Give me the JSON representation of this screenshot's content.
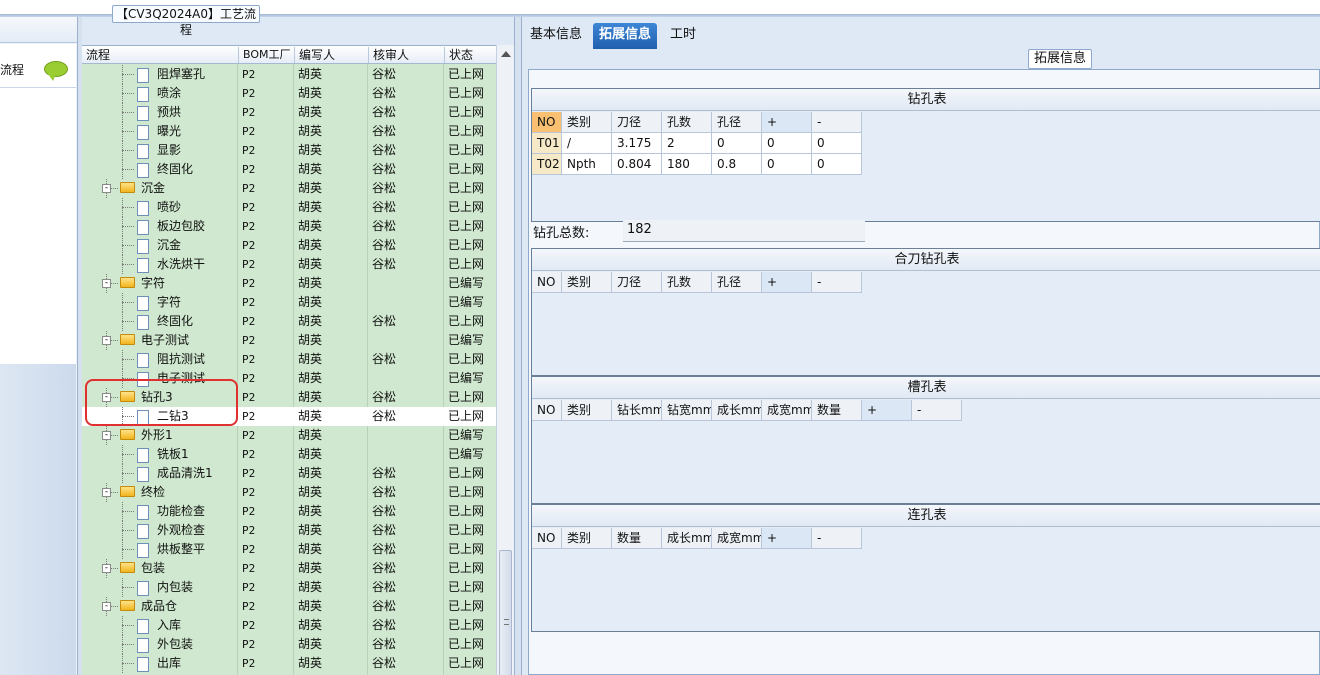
{
  "left_panel": {
    "flow_label": "流程"
  },
  "middle": {
    "title": "【CV3Q2024A0】工艺流程",
    "columns": [
      "流程",
      "BOM工厂",
      "编写人",
      "核审人",
      "状态"
    ],
    "rows": [
      {
        "indent": 2,
        "type": "file",
        "name": "阻焊塞孔",
        "bom": "P2",
        "writer": "胡英",
        "reviewer": "谷松",
        "status": "已上网"
      },
      {
        "indent": 2,
        "type": "file",
        "name": "喷涂",
        "bom": "P2",
        "writer": "胡英",
        "reviewer": "谷松",
        "status": "已上网"
      },
      {
        "indent": 2,
        "type": "file",
        "name": "预烘",
        "bom": "P2",
        "writer": "胡英",
        "reviewer": "谷松",
        "status": "已上网"
      },
      {
        "indent": 2,
        "type": "file",
        "name": "曝光",
        "bom": "P2",
        "writer": "胡英",
        "reviewer": "谷松",
        "status": "已上网"
      },
      {
        "indent": 2,
        "type": "file",
        "name": "显影",
        "bom": "P2",
        "writer": "胡英",
        "reviewer": "谷松",
        "status": "已上网"
      },
      {
        "indent": 2,
        "type": "file",
        "name": "终固化",
        "bom": "P2",
        "writer": "胡英",
        "reviewer": "谷松",
        "status": "已上网"
      },
      {
        "indent": 1,
        "type": "folder",
        "name": "沉金",
        "bom": "P2",
        "writer": "胡英",
        "reviewer": "谷松",
        "status": "已上网"
      },
      {
        "indent": 2,
        "type": "file",
        "name": "喷砂",
        "bom": "P2",
        "writer": "胡英",
        "reviewer": "谷松",
        "status": "已上网"
      },
      {
        "indent": 2,
        "type": "file",
        "name": "板边包胶",
        "bom": "P2",
        "writer": "胡英",
        "reviewer": "谷松",
        "status": "已上网"
      },
      {
        "indent": 2,
        "type": "file",
        "name": "沉金",
        "bom": "P2",
        "writer": "胡英",
        "reviewer": "谷松",
        "status": "已上网"
      },
      {
        "indent": 2,
        "type": "file",
        "name": "水洗烘干",
        "bom": "P2",
        "writer": "胡英",
        "reviewer": "谷松",
        "status": "已上网"
      },
      {
        "indent": 1,
        "type": "folder",
        "name": "字符",
        "bom": "P2",
        "writer": "胡英",
        "reviewer": "",
        "status": "已编写"
      },
      {
        "indent": 2,
        "type": "file",
        "name": "字符",
        "bom": "P2",
        "writer": "胡英",
        "reviewer": "",
        "status": "已编写"
      },
      {
        "indent": 2,
        "type": "file",
        "name": "终固化",
        "bom": "P2",
        "writer": "胡英",
        "reviewer": "谷松",
        "status": "已上网"
      },
      {
        "indent": 1,
        "type": "folder",
        "name": "电子测试",
        "bom": "P2",
        "writer": "胡英",
        "reviewer": "",
        "status": "已编写"
      },
      {
        "indent": 2,
        "type": "file",
        "name": "阻抗测试",
        "bom": "P2",
        "writer": "胡英",
        "reviewer": "谷松",
        "status": "已上网"
      },
      {
        "indent": 2,
        "type": "file",
        "name": "电子测试",
        "bom": "P2",
        "writer": "胡英",
        "reviewer": "",
        "status": "已编写"
      },
      {
        "indent": 1,
        "type": "folder",
        "name": "钻孔3",
        "bom": "P2",
        "writer": "胡英",
        "reviewer": "谷松",
        "status": "已上网"
      },
      {
        "indent": 2,
        "type": "file",
        "name": "二钻3",
        "bom": "P2",
        "writer": "胡英",
        "reviewer": "谷松",
        "status": "已上网",
        "selected": true
      },
      {
        "indent": 1,
        "type": "folder",
        "name": "外形1",
        "bom": "P2",
        "writer": "胡英",
        "reviewer": "",
        "status": "已编写"
      },
      {
        "indent": 2,
        "type": "file",
        "name": "铣板1",
        "bom": "P2",
        "writer": "胡英",
        "reviewer": "",
        "status": "已编写"
      },
      {
        "indent": 2,
        "type": "file",
        "name": "成品清洗1",
        "bom": "P2",
        "writer": "胡英",
        "reviewer": "谷松",
        "status": "已上网"
      },
      {
        "indent": 1,
        "type": "folder",
        "name": "终检",
        "bom": "P2",
        "writer": "胡英",
        "reviewer": "谷松",
        "status": "已上网"
      },
      {
        "indent": 2,
        "type": "file",
        "name": "功能检查",
        "bom": "P2",
        "writer": "胡英",
        "reviewer": "谷松",
        "status": "已上网"
      },
      {
        "indent": 2,
        "type": "file",
        "name": "外观检查",
        "bom": "P2",
        "writer": "胡英",
        "reviewer": "谷松",
        "status": "已上网"
      },
      {
        "indent": 2,
        "type": "file",
        "name": "烘板整平",
        "bom": "P2",
        "writer": "胡英",
        "reviewer": "谷松",
        "status": "已上网"
      },
      {
        "indent": 1,
        "type": "folder",
        "name": "包装",
        "bom": "P2",
        "writer": "胡英",
        "reviewer": "谷松",
        "status": "已上网"
      },
      {
        "indent": 2,
        "type": "file",
        "name": "内包装",
        "bom": "P2",
        "writer": "胡英",
        "reviewer": "谷松",
        "status": "已上网"
      },
      {
        "indent": 1,
        "type": "folder",
        "name": "成品仓",
        "bom": "P2",
        "writer": "胡英",
        "reviewer": "谷松",
        "status": "已上网"
      },
      {
        "indent": 2,
        "type": "file",
        "name": "入库",
        "bom": "P2",
        "writer": "胡英",
        "reviewer": "谷松",
        "status": "已上网"
      },
      {
        "indent": 2,
        "type": "file",
        "name": "外包装",
        "bom": "P2",
        "writer": "胡英",
        "reviewer": "谷松",
        "status": "已上网"
      },
      {
        "indent": 2,
        "type": "file",
        "name": "出库",
        "bom": "P2",
        "writer": "胡英",
        "reviewer": "谷松",
        "status": "已上网"
      }
    ]
  },
  "right": {
    "tabs": [
      "基本信息",
      "拓展信息",
      "工时"
    ],
    "active_tab": "拓展信息",
    "panel_title": "拓展信息",
    "drill_table": {
      "title": "钻孔表",
      "headers": [
        "NO",
        "类别",
        "刀径",
        "孔数",
        "孔径",
        "+",
        "-"
      ],
      "rows": [
        [
          "T01",
          "/",
          "3.175",
          "2",
          "0",
          "0",
          "0"
        ],
        [
          "T02",
          "Npth",
          "0.804",
          "180",
          "0.8",
          "0",
          "0"
        ]
      ]
    },
    "total_label": "钻孔总数:",
    "total_value": "182",
    "merge_table": {
      "title": "合刀钻孔表",
      "headers": [
        "NO",
        "类别",
        "刀径",
        "孔数",
        "孔径",
        "+",
        "-"
      ]
    },
    "slot_table": {
      "title": "槽孔表",
      "headers": [
        "NO",
        "类别",
        "钻长mm",
        "钻宽mm",
        "成长mm",
        "成宽mm",
        "数量",
        "+",
        "-"
      ]
    },
    "link_table": {
      "title": "连孔表",
      "headers": [
        "NO",
        "类别",
        "数量",
        "成长mm",
        "成宽mm",
        "+",
        "-"
      ]
    }
  }
}
